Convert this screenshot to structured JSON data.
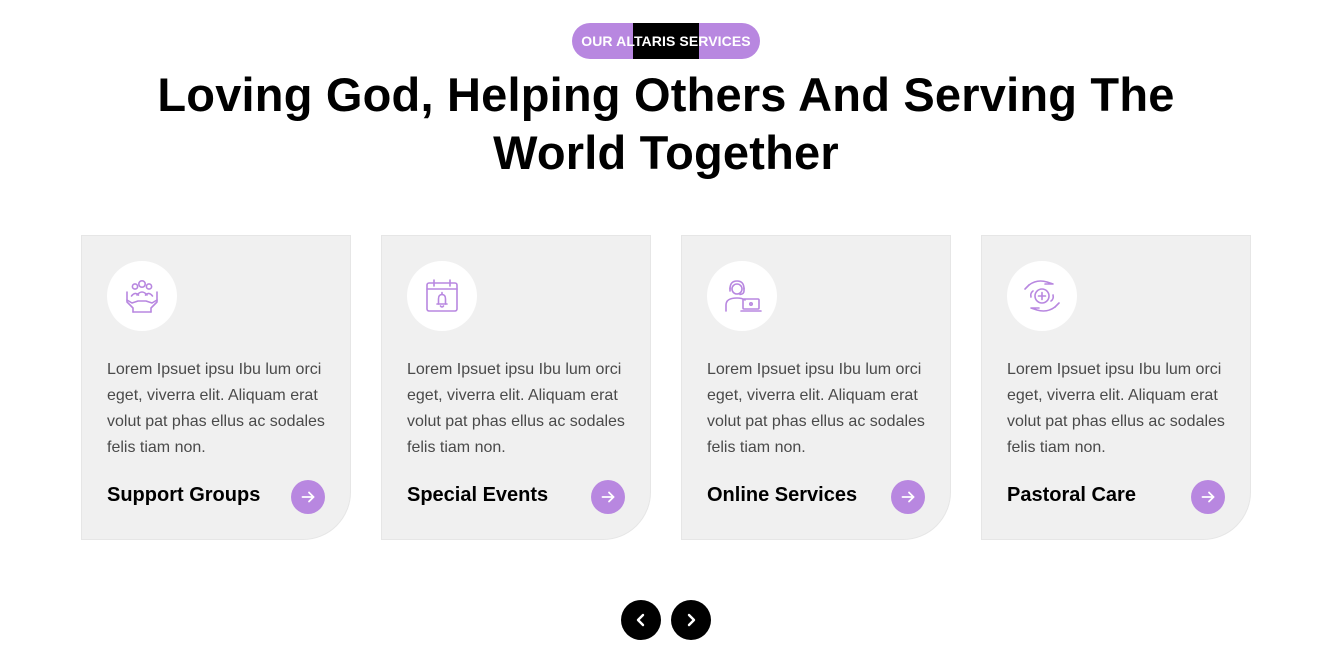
{
  "eyebrow": {
    "label": "OUR ALTARIS SERVICES"
  },
  "heading": "Loving God, Helping Others And Serving The World Together",
  "colors": {
    "accent": "#b887e0",
    "card_bg": "#f0f0f0",
    "dark": "#000000"
  },
  "cards": [
    {
      "icon": "helping-hands-icon",
      "description": "Lorem Ipsuet ipsu Ibu lum orci eget, viverra elit. Aliquam erat volut pat phas ellus ac sodales felis tiam non.",
      "title": "Support Groups"
    },
    {
      "icon": "calendar-bell-icon",
      "description": "Lorem Ipsuet ipsu Ibu lum orci eget, viverra elit. Aliquam erat volut pat phas ellus ac sodales felis tiam non.",
      "title": "Special Events"
    },
    {
      "icon": "online-support-icon",
      "description": "Lorem Ipsuet ipsu Ibu lum orci eget, viverra elit. Aliquam erat volut pat phas ellus ac sodales felis tiam non.",
      "title": "Online Services"
    },
    {
      "icon": "care-hands-icon",
      "description": "Lorem Ipsuet ipsu Ibu lum orci eget, viverra elit. Aliquam erat volut pat phas ellus ac sodales felis tiam non.",
      "title": "Pastoral Care"
    }
  ],
  "slider_nav": {
    "prev_icon": "chevron-left-icon",
    "next_icon": "chevron-right-icon"
  }
}
